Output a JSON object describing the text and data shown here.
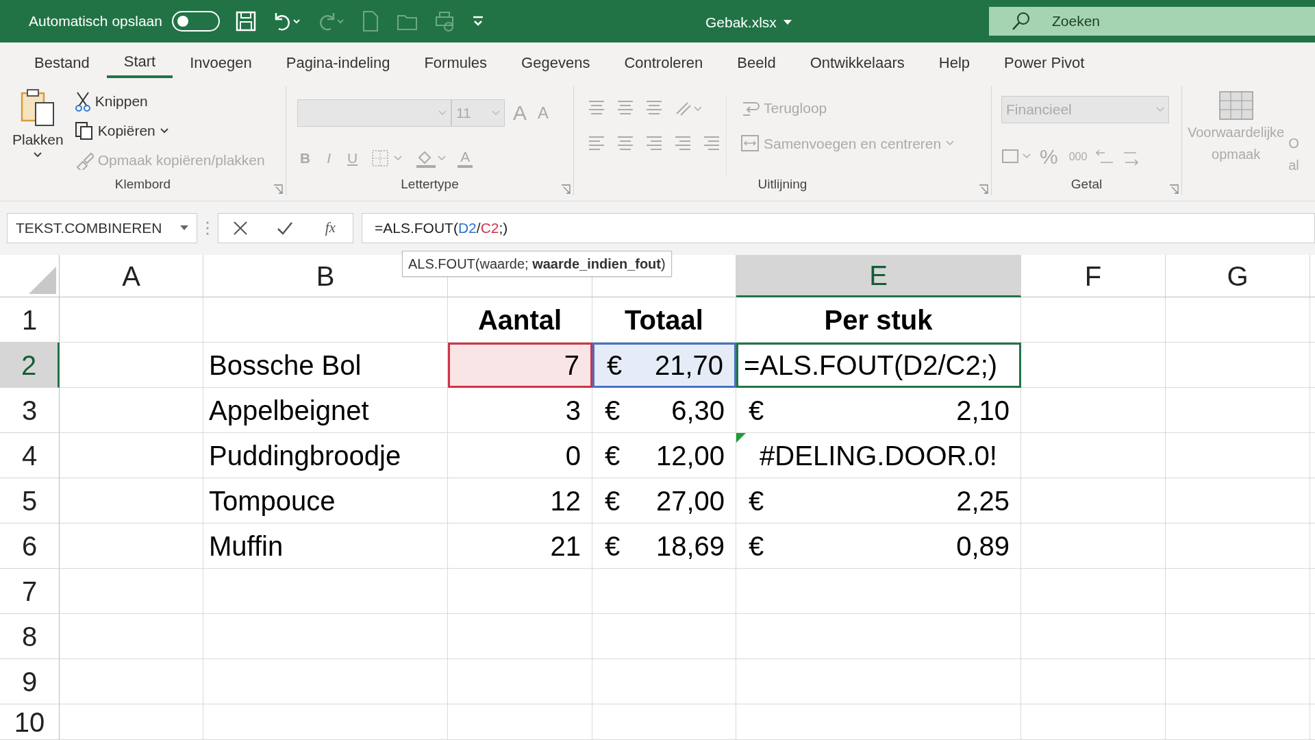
{
  "title_bar": {
    "autosave_label": "Automatisch opslaan",
    "autosave_on": false,
    "file_name": "Gebak.xlsx",
    "search_placeholder": "Zoeken"
  },
  "menu_tabs": [
    {
      "label": "Bestand",
      "selected": false
    },
    {
      "label": "Start",
      "selected": true
    },
    {
      "label": "Invoegen",
      "selected": false
    },
    {
      "label": "Pagina-indeling",
      "selected": false
    },
    {
      "label": "Formules",
      "selected": false
    },
    {
      "label": "Gegevens",
      "selected": false
    },
    {
      "label": "Controleren",
      "selected": false
    },
    {
      "label": "Beeld",
      "selected": false
    },
    {
      "label": "Ontwikkelaars",
      "selected": false
    },
    {
      "label": "Help",
      "selected": false
    },
    {
      "label": "Power Pivot",
      "selected": false
    }
  ],
  "ribbon": {
    "clipboard": {
      "label": "Klembord",
      "paste": "Plakken",
      "cut": "Knippen",
      "copy": "Kopiëren",
      "format_painter": "Opmaak kopiëren/plakken",
      "format_painter_disabled": true
    },
    "font": {
      "label": "Lettertype",
      "size": "11",
      "grow": "A",
      "shrink": "A",
      "bold": "B",
      "italic": "I",
      "underline": "U",
      "font_color": "A",
      "disabled": true
    },
    "alignment": {
      "label": "Uitlijning",
      "wrap": "Terugloop",
      "merge": "Samenvoegen en centreren",
      "disabled": true
    },
    "number": {
      "label": "Getal",
      "format": "Financieel",
      "percent": "%",
      "thousands": "000",
      "disabled": true
    },
    "styles": {
      "conditional": [
        "Voorwaardelijke",
        "opmaak"
      ],
      "next_cut": [
        "O",
        "al"
      ],
      "disabled": true
    }
  },
  "formula_bar": {
    "name_box": "TEKST.COMBINEREN",
    "function_label": "fx",
    "formula": [
      {
        "text": "=ALS.FOUT("
      },
      {
        "text": "D2",
        "color": "#2f6fd0"
      },
      {
        "text": "/"
      },
      {
        "text": "C2",
        "color": "#d03347"
      },
      {
        "text": ";)"
      }
    ]
  },
  "tooltip": "ALS.FOUT(waarde; **waarde_indien_fout**)",
  "columns": [
    {
      "label": "A",
      "selected": false
    },
    {
      "label": "B",
      "selected": false
    },
    {
      "selected": false
    },
    {
      "selected": false
    },
    {
      "label": "E",
      "selected": true
    },
    {
      "label": "F",
      "selected": false
    },
    {
      "label": "G",
      "selected": false
    }
  ],
  "rows": [
    {
      "number": "1",
      "selected": false,
      "cells": [
        {
          "kind": "empty"
        },
        {
          "kind": "empty"
        },
        {
          "kind": "header",
          "text": "Aantal"
        },
        {
          "kind": "header",
          "text": "Totaal"
        },
        {
          "kind": "header",
          "text": "Per stuk"
        },
        {
          "kind": "empty"
        },
        {
          "kind": "empty"
        }
      ]
    },
    {
      "number": "2",
      "selected": true,
      "cells": [
        {
          "kind": "empty"
        },
        {
          "kind": "text",
          "text": "Bossche Bol"
        },
        {
          "kind": "number",
          "text": "7",
          "color": "#d03347"
        },
        {
          "kind": "currency",
          "symbol": "€",
          "text": "21,70",
          "color": "#4472c4"
        },
        {
          "kind": "edit",
          "text": "=ALS.FOUT(D2/C2;)",
          "active": true
        },
        {
          "kind": "empty"
        },
        {
          "kind": "empty"
        }
      ]
    },
    {
      "number": "3",
      "selected": false,
      "cells": [
        {
          "kind": "empty"
        },
        {
          "kind": "text",
          "text": "Appelbeignet"
        },
        {
          "kind": "number",
          "text": "3"
        },
        {
          "kind": "currency",
          "symbol": "€",
          "text": "6,30"
        },
        {
          "kind": "currency",
          "symbol": "€",
          "text": "2,10"
        },
        {
          "kind": "empty"
        },
        {
          "kind": "empty"
        }
      ]
    },
    {
      "number": "4",
      "selected": false,
      "cells": [
        {
          "kind": "empty"
        },
        {
          "kind": "text",
          "text": "Puddingbroodje"
        },
        {
          "kind": "number",
          "text": "0"
        },
        {
          "kind": "currency",
          "symbol": "€",
          "text": "12,00"
        },
        {
          "kind": "error",
          "text": "#DELING.DOOR.0!"
        },
        {
          "kind": "empty"
        },
        {
          "kind": "empty"
        }
      ]
    },
    {
      "number": "5",
      "selected": false,
      "cells": [
        {
          "kind": "empty"
        },
        {
          "kind": "text",
          "text": "Tompouce"
        },
        {
          "kind": "number",
          "text": "12"
        },
        {
          "kind": "currency",
          "symbol": "€",
          "text": "27,00"
        },
        {
          "kind": "currency",
          "symbol": "€",
          "text": "2,25"
        },
        {
          "kind": "empty"
        },
        {
          "kind": "empty"
        }
      ]
    },
    {
      "number": "6",
      "selected": false,
      "cells": [
        {
          "kind": "empty"
        },
        {
          "kind": "text",
          "text": "Muffin"
        },
        {
          "kind": "number",
          "text": "21"
        },
        {
          "kind": "currency",
          "symbol": "€",
          "text": "18,69"
        },
        {
          "kind": "currency",
          "symbol": "€",
          "text": "0,89"
        },
        {
          "kind": "empty"
        },
        {
          "kind": "empty"
        }
      ]
    },
    {
      "number": "7",
      "selected": false
    },
    {
      "number": "8",
      "selected": false
    },
    {
      "number": "9",
      "selected": false
    },
    {
      "number": "10",
      "selected": false
    }
  ]
}
